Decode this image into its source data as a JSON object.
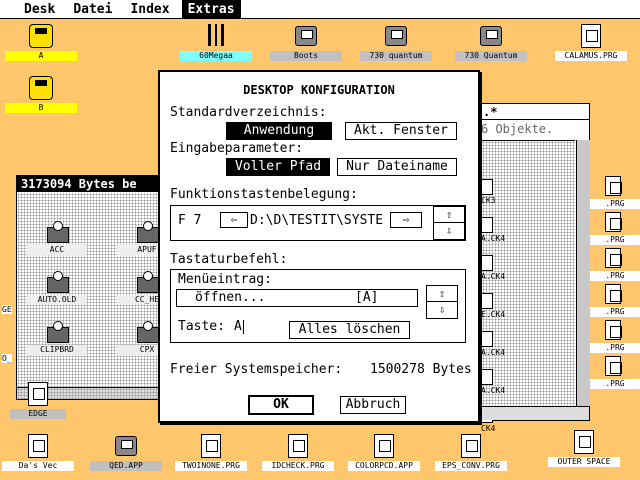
{
  "menu": [
    "Desk",
    "Datei",
    "Index",
    "Extras"
  ],
  "menu_active": 3,
  "top_icons": [
    {
      "label": "A",
      "color": "y",
      "type": "yellow"
    },
    {
      "label": "60Megaa",
      "color": "c",
      "type": "atari"
    },
    {
      "label": "Boots",
      "color": "g",
      "type": "drive"
    },
    {
      "label": "730 quantum",
      "color": "g",
      "type": "drive"
    },
    {
      "label": "730 Quantum",
      "color": "g",
      "type": "drive"
    },
    {
      "label": "CALAMUS.PRG",
      "color": "w",
      "type": "prg"
    }
  ],
  "side_icons": [
    {
      "label": "B",
      "color": "y",
      "type": "yellow"
    }
  ],
  "bottom_icons": [
    {
      "label": "Da's Vec",
      "color": "w",
      "type": "prg"
    },
    {
      "label": "QED.APP",
      "color": "g",
      "type": "drive"
    },
    {
      "label": "TWOINONE.PRG",
      "color": "w",
      "type": "prg"
    },
    {
      "label": "IDCHECK.PRG",
      "color": "w",
      "type": "prg"
    },
    {
      "label": "COLORPCD.APP",
      "color": "w",
      "type": "prg"
    },
    {
      "label": "EPS_CONV.PRG",
      "color": "w",
      "type": "prg"
    },
    {
      "label": "OUTER SPACE",
      "color": "w",
      "type": "prg"
    }
  ],
  "left_window": {
    "title": "3173094 Bytes be",
    "files": [
      "ACC",
      "APUF",
      "AUTO.OLD",
      "CC_HE",
      "CLIPBRD",
      "CPX"
    ],
    "edge_label": "EDGE",
    "cut_labels": [
      "GE",
      "O_"
    ]
  },
  "right_window": {
    "title": ".*",
    "info": "6 Objekte.",
    "items": [
      "CK3",
      "A.CK4",
      "A.CK4",
      "E.CK4",
      "A.CK4",
      "A.CK4",
      "CK4"
    ],
    "side_labels": [
      ".PRG",
      ".PRG",
      ".PRG",
      ".PRG",
      ".PRG",
      ".PRG"
    ]
  },
  "dialog": {
    "title": "DESKTOP KONFIGURATION",
    "std_dir_label": "Standardverzeichnis:",
    "std_dir_opt1": "Anwendung",
    "std_dir_opt2": "Akt. Fenster",
    "input_label": "Eingabeparameter:",
    "input_opt1": "Voller Pfad",
    "input_opt2": "Nur Dateiname",
    "fkey_label": "Funktionstastenbelegung:",
    "fkey_name": "F 7",
    "fkey_left": "⇦",
    "fkey_path": "D:\\D\\TESTIT\\SYSTE",
    "fkey_right": "⇨",
    "up_arrow": "⇧",
    "down_arrow": "⇩",
    "kbd_label": "Tastaturbefehl:",
    "menu_entry_label": "Menüeintrag:",
    "menu_entry_value": "öffnen...",
    "menu_entry_key": "[A]",
    "key_label": "Taste:",
    "key_value": "A",
    "clear_button": "Alles löschen",
    "mem_label": "Freier Systemspeicher:",
    "mem_value": "1500278 Bytes",
    "ok_button": "OK",
    "cancel_button": "Abbruch"
  }
}
